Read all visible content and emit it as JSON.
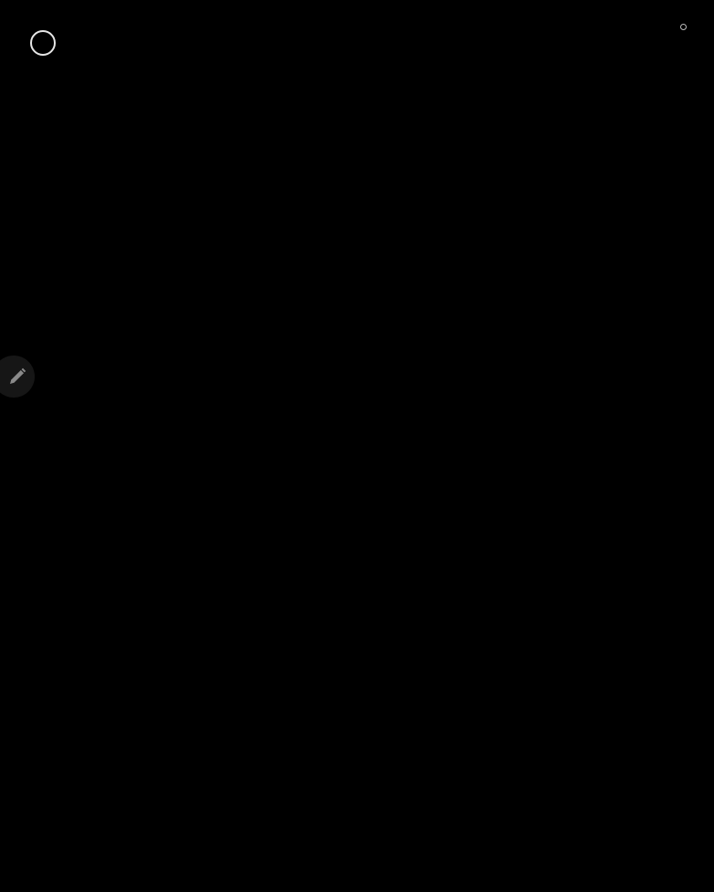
{
  "screen": {
    "background_color": "#000000"
  },
  "top_left_control": {
    "icon": "circle-outline-icon",
    "color": "#e6e6e6"
  },
  "top_right_indicator": {
    "icon": "small-circle-icon",
    "color": "#bdbdbd"
  },
  "edge_tool_handle": {
    "icon": "pencil-icon",
    "background_color": "#161616",
    "icon_color": "#8a8a8a"
  }
}
